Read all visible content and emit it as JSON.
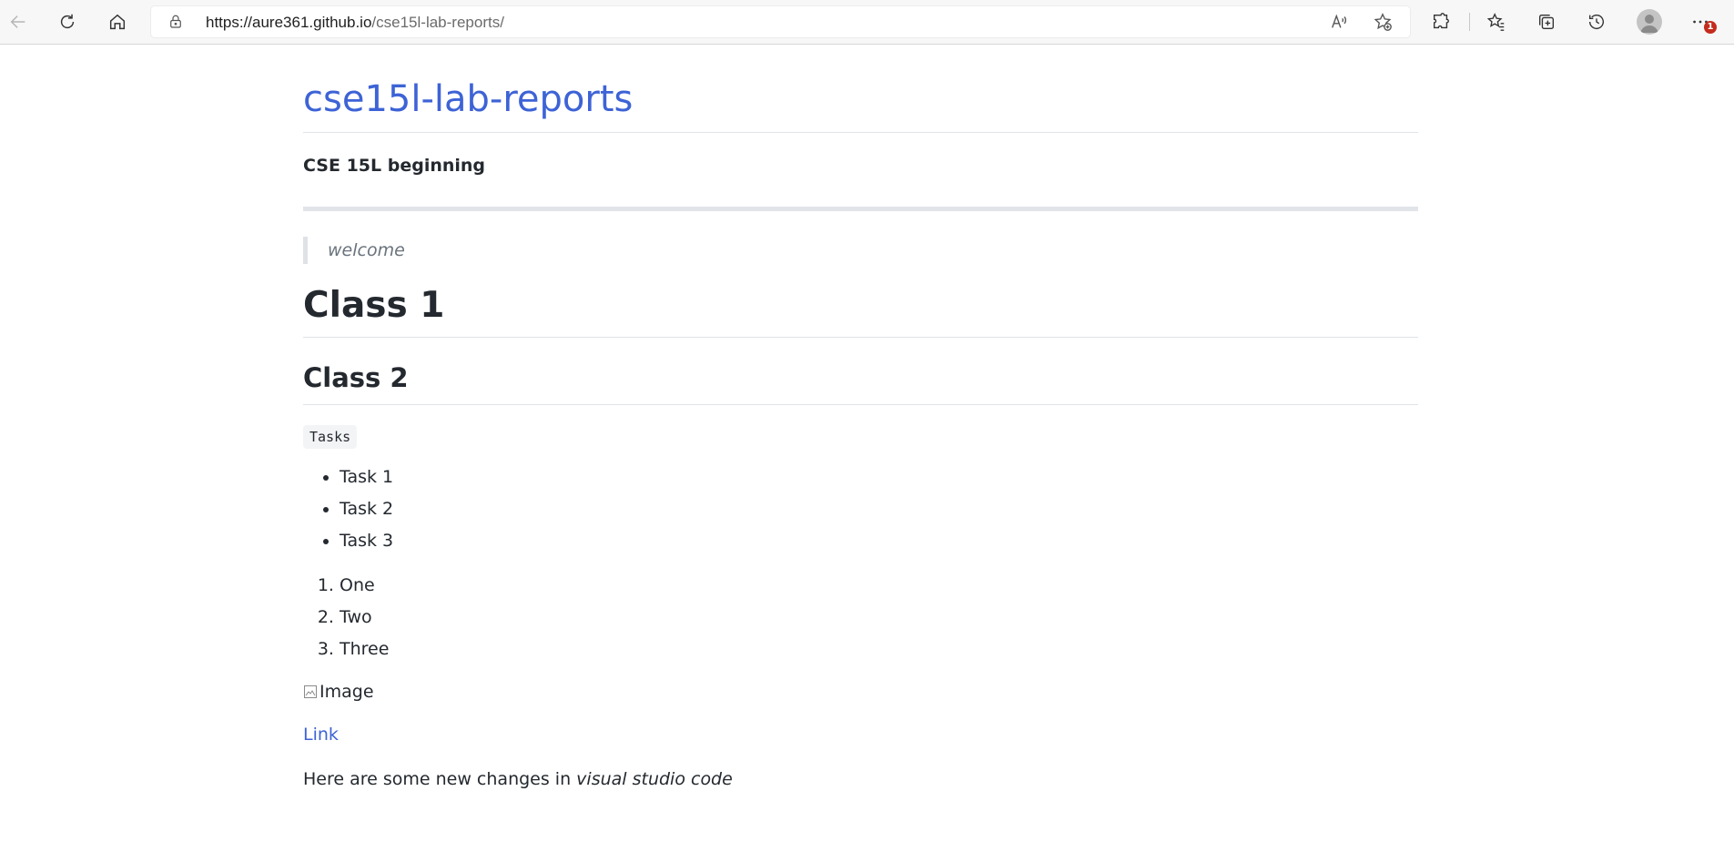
{
  "browser": {
    "url_host": "https://aure361.github.io",
    "url_path": "/cse15l-lab-reports/",
    "notification_count": "1"
  },
  "page": {
    "site_title": "cse15l-lab-reports",
    "tagline": "CSE 15L beginning",
    "blockquote": "welcome",
    "heading1": "Class 1",
    "heading2": "Class 2",
    "code_label": "Tasks",
    "bullet_items": [
      "Task 1",
      "Task 2",
      "Task 3"
    ],
    "numbered_items": [
      "One",
      "Two",
      "Three"
    ],
    "image_alt": "Image",
    "link_text": "Link",
    "paragraph_prefix": "Here are some new changes in ",
    "paragraph_emphasis": "visual studio code"
  },
  "colors": {
    "link": "#3d63d6",
    "text": "#24292f",
    "muted": "#6a737d"
  }
}
